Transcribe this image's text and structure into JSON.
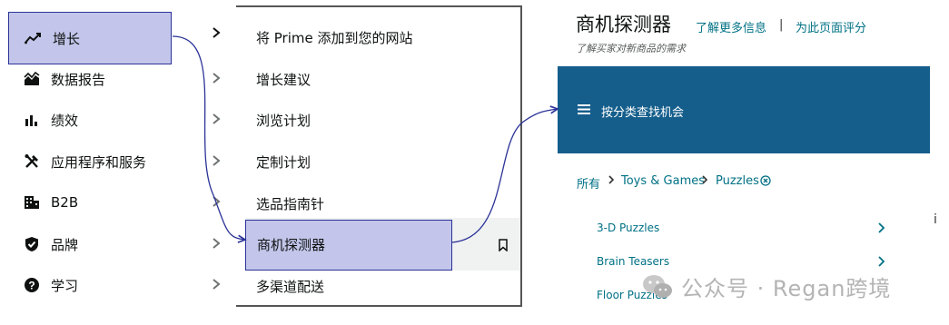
{
  "nav": {
    "items": [
      {
        "label": "增长",
        "icon": "growth-chart-icon"
      },
      {
        "label": "数据报告",
        "icon": "data-report-icon"
      },
      {
        "label": "绩效",
        "icon": "bar-chart-icon"
      },
      {
        "label": "应用程序和服务",
        "icon": "tools-icon"
      },
      {
        "label": "B2B",
        "icon": "building-icon"
      },
      {
        "label": "品牌",
        "icon": "shield-check-icon"
      },
      {
        "label": "学习",
        "icon": "question-icon"
      }
    ]
  },
  "submenu": {
    "items": [
      {
        "label": "将 Prime 添加到您的网站"
      },
      {
        "label": "增长建议"
      },
      {
        "label": "浏览计划"
      },
      {
        "label": "定制计划"
      },
      {
        "label": "选品指南针"
      },
      {
        "label": "商机探测器"
      },
      {
        "label": "多渠道配送"
      }
    ]
  },
  "page": {
    "title": "商机探测器",
    "learn_more": "了解更多信息",
    "separator": "|",
    "rate_page": "为此页面评分",
    "subtitle": "了解买家对新商品的需求"
  },
  "banner": {
    "label": "按分类查找机会",
    "color": "#155e8c"
  },
  "breadcrumb": {
    "items": [
      "所有",
      "Toys & Games",
      "Puzzles"
    ]
  },
  "categories": [
    {
      "label": "3-D Puzzles"
    },
    {
      "label": "Brain Teasers"
    },
    {
      "label": "Floor Puzzles"
    }
  ],
  "edge_mark": "i",
  "watermark": {
    "text": "公众号 · Regan跨境"
  },
  "colors": {
    "highlight": "#c3c6ea",
    "highlight_border": "#2b3397",
    "link": "#007185"
  }
}
